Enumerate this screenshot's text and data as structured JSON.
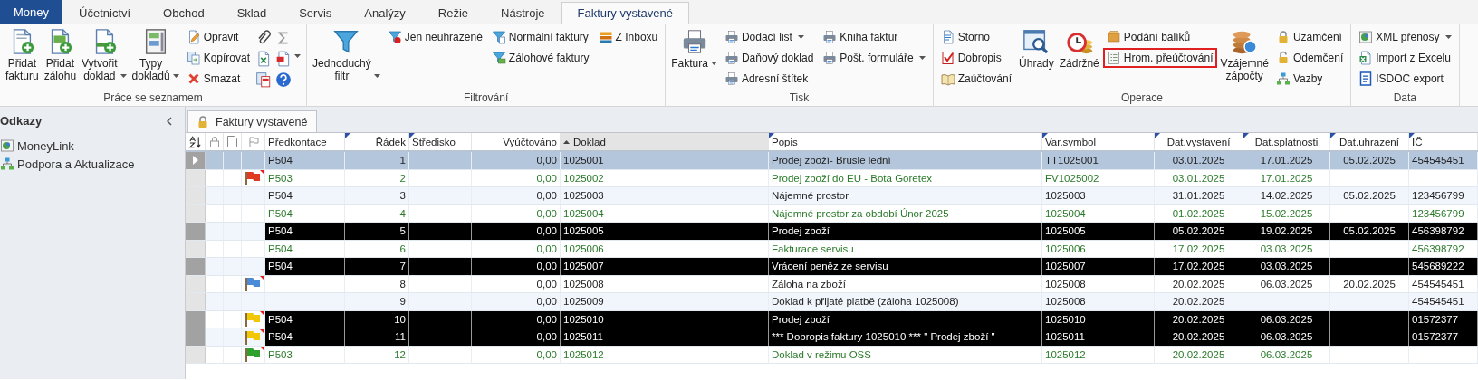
{
  "tabs": [
    {
      "label": "Money",
      "kind": "app",
      "selected": false
    },
    {
      "label": "Účetnictví",
      "kind": "tab",
      "selected": false
    },
    {
      "label": "Obchod",
      "kind": "tab",
      "selected": false
    },
    {
      "label": "Sklad",
      "kind": "tab",
      "selected": false
    },
    {
      "label": "Servis",
      "kind": "tab",
      "selected": false
    },
    {
      "label": "Analýzy",
      "kind": "tab",
      "selected": false
    },
    {
      "label": "Režie",
      "kind": "tab",
      "selected": false
    },
    {
      "label": "Nástroje",
      "kind": "tab",
      "selected": false
    },
    {
      "label": "Faktury vystavené",
      "kind": "tab",
      "selected": true
    }
  ],
  "ribbon": {
    "groups": [
      {
        "label": "Práce se seznamem",
        "columns": [
          {
            "kind": "large",
            "label": "Přidat fakturu",
            "dropdown": false
          },
          {
            "kind": "large",
            "label": "Přidat zálohu",
            "dropdown": false
          },
          {
            "kind": "large",
            "label": "Vytvořit doklad",
            "dropdown": true
          },
          {
            "kind": "large",
            "label": "Typy dokladů",
            "dropdown": true
          },
          {
            "kind": "stack",
            "items": [
              {
                "label": "Opravit",
                "dropdown": false,
                "highlighted": false
              },
              {
                "label": "Kopírovat",
                "dropdown": false,
                "highlighted": false
              },
              {
                "label": "Smazat",
                "dropdown": false,
                "highlighted": false
              }
            ]
          },
          {
            "kind": "icons"
          }
        ]
      },
      {
        "label": "Filtrování",
        "columns": [
          {
            "kind": "large",
            "label": "Jednoduchý filtr",
            "dropdown": true
          },
          {
            "kind": "stack",
            "items": [
              {
                "label": "Jen neuhrazené",
                "dropdown": false,
                "highlighted": false
              }
            ]
          },
          {
            "kind": "stack",
            "items": [
              {
                "label": "Normální faktury",
                "dropdown": false,
                "highlighted": false
              },
              {
                "label": "Zálohové faktury",
                "dropdown": false,
                "highlighted": false
              }
            ]
          },
          {
            "kind": "stack",
            "items": [
              {
                "label": "Z Inboxu",
                "dropdown": false,
                "highlighted": false
              }
            ]
          }
        ]
      },
      {
        "label": "Tisk",
        "columns": [
          {
            "kind": "large",
            "label": "Faktura",
            "dropdown": true
          },
          {
            "kind": "stack",
            "items": [
              {
                "label": "Dodací list",
                "dropdown": true,
                "highlighted": false
              },
              {
                "label": "Daňový doklad",
                "dropdown": false,
                "highlighted": false
              },
              {
                "label": "Adresní štítek",
                "dropdown": false,
                "highlighted": false
              }
            ]
          },
          {
            "kind": "stack",
            "items": [
              {
                "label": "Kniha faktur",
                "dropdown": false,
                "highlighted": false
              },
              {
                "label": "Pošt. formuláře",
                "dropdown": true,
                "highlighted": false
              }
            ]
          }
        ]
      },
      {
        "label": "Operace",
        "columns": [
          {
            "kind": "stack",
            "items": [
              {
                "label": "Storno",
                "dropdown": false,
                "highlighted": false
              },
              {
                "label": "Dobropis",
                "dropdown": false,
                "highlighted": false
              },
              {
                "label": "Zaúčtování",
                "dropdown": false,
                "highlighted": false
              }
            ]
          },
          {
            "kind": "large",
            "label": "Úhrady",
            "dropdown": false
          },
          {
            "kind": "large",
            "label": "Zádržné",
            "dropdown": false
          },
          {
            "kind": "stack",
            "items": [
              {
                "label": "Podání balíků",
                "dropdown": false,
                "highlighted": false
              },
              {
                "label": "Hrom. přeúčtování",
                "dropdown": false,
                "highlighted": true
              }
            ]
          },
          {
            "kind": "large",
            "label": "Vzájemné zápočty",
            "dropdown": false
          },
          {
            "kind": "stack",
            "items": [
              {
                "label": "Uzamčení",
                "dropdown": false,
                "highlighted": false
              },
              {
                "label": "Odemčení",
                "dropdown": false,
                "highlighted": false
              },
              {
                "label": "Vazby",
                "dropdown": false,
                "highlighted": false
              }
            ]
          }
        ]
      },
      {
        "label": "Data",
        "columns": [
          {
            "kind": "stack",
            "items": [
              {
                "label": "XML přenosy",
                "dropdown": true,
                "highlighted": false
              },
              {
                "label": "Import z Excelu",
                "dropdown": false,
                "highlighted": false
              },
              {
                "label": "ISDOC export",
                "dropdown": false,
                "highlighted": false
              }
            ]
          }
        ]
      }
    ]
  },
  "sidebar": {
    "title": "Odkazy",
    "links": [
      {
        "label": "MoneyLink"
      },
      {
        "label": "Podpora a Aktualizace"
      }
    ]
  },
  "document_tab": {
    "label": "Faktury vystavené"
  },
  "table": {
    "columns": [
      {
        "label": "Předkontace",
        "marked": false,
        "sorted": false
      },
      {
        "label": "Řádek",
        "marked": true,
        "sorted": false
      },
      {
        "label": "Středisko",
        "marked": true,
        "sorted": false
      },
      {
        "label": "Vyúčtováno",
        "marked": false,
        "sorted": false
      },
      {
        "label": "Doklad",
        "marked": false,
        "sorted": true
      },
      {
        "label": "Popis",
        "marked": true,
        "sorted": false
      },
      {
        "label": "Var.symbol",
        "marked": true,
        "sorted": false
      },
      {
        "label": "Dat.vystavení",
        "marked": true,
        "sorted": false
      },
      {
        "label": "Dat.splatnosti",
        "marked": true,
        "sorted": false
      },
      {
        "label": "Dat.uhrazení",
        "marked": true,
        "sorted": false
      },
      {
        "label": "IČ",
        "marked": true,
        "sorted": false
      }
    ],
    "rows": [
      {
        "kind": "normal",
        "selected": true,
        "cells": [
          "P504",
          "1",
          null,
          "0,00",
          "1025001",
          "Prodej zboží- Brusle lední",
          "TT1025001",
          "03.01.2025",
          "17.01.2025",
          "05.02.2025",
          "454545451"
        ]
      },
      {
        "kind": "green",
        "selected": false,
        "color": "#e03a22",
        "cells": [
          "P503",
          "2",
          null,
          "0,00",
          "1025002",
          "Prodej zboží do EU - Bota Goretex",
          "FV1025002",
          "03.01.2025",
          "17.01.2025",
          null,
          null
        ]
      },
      {
        "kind": "normal",
        "selected": false,
        "cells": [
          "P504",
          "3",
          null,
          "0,00",
          "1025003",
          "Nájemné prostor",
          "1025003",
          "31.01.2025",
          "14.02.2025",
          "05.02.2025",
          "123456799"
        ]
      },
      {
        "kind": "green",
        "selected": false,
        "cells": [
          "P504",
          "4",
          null,
          "0,00",
          "1025004",
          "Nájemné prostor za období Únor 2025",
          "1025004",
          "01.02.2025",
          "15.02.2025",
          null,
          "123456799"
        ]
      },
      {
        "kind": "dark",
        "selected": false,
        "cells": [
          "P504",
          "5",
          null,
          "0,00",
          "1025005",
          "Prodej zboží",
          "1025005",
          "05.02.2025",
          "19.02.2025",
          "05.02.2025",
          "456398792"
        ]
      },
      {
        "kind": "green",
        "selected": false,
        "cells": [
          "P504",
          "6",
          null,
          "0,00",
          "1025006",
          "Fakturace servisu",
          "1025006",
          "17.02.2025",
          "03.03.2025",
          null,
          "456398792"
        ]
      },
      {
        "kind": "dark",
        "selected": false,
        "cells": [
          "P504",
          "7",
          null,
          "0,00",
          "1025007",
          "Vrácení peněz ze servisu",
          "1025007",
          "17.02.2025",
          "03.03.2025",
          null,
          "545689222"
        ]
      },
      {
        "kind": "normal",
        "selected": false,
        "color": "#4a8ad6",
        "cells": [
          null,
          "8",
          null,
          "0,00",
          "1025008",
          "Záloha na zboží",
          "1025008",
          "20.02.2025",
          "06.03.2025",
          "20.02.2025",
          "454545451"
        ]
      },
      {
        "kind": "normal",
        "selected": false,
        "cells": [
          null,
          "9",
          null,
          "0,00",
          "1025009",
          "Doklad k přijaté platbě (záloha 1025008)",
          "1025008",
          "20.02.2025",
          null,
          null,
          "454545451"
        ]
      },
      {
        "kind": "dark",
        "selected": false,
        "color": "#f0c808",
        "cells": [
          "P504",
          "10",
          null,
          "0,00",
          "1025010",
          "Prodej zboží",
          "1025010",
          "20.02.2025",
          "06.03.2025",
          null,
          "01572377"
        ]
      },
      {
        "kind": "dark",
        "selected": false,
        "color": "#f0c808",
        "cells": [
          "P504",
          "11",
          null,
          "0,00",
          "1025011",
          "*** Dobropis faktury 1025010 *** \" Prodej zboží \"",
          "1025011",
          "20.02.2025",
          "06.03.2025",
          null,
          "01572377"
        ]
      },
      {
        "kind": "green",
        "selected": false,
        "color": "#2ea02e",
        "cells": [
          "P503",
          "12",
          null,
          "0,00",
          "1025012",
          "Doklad v režimu OSS",
          "1025012",
          "20.02.2025",
          "06.03.2025",
          null,
          null
        ]
      }
    ]
  }
}
